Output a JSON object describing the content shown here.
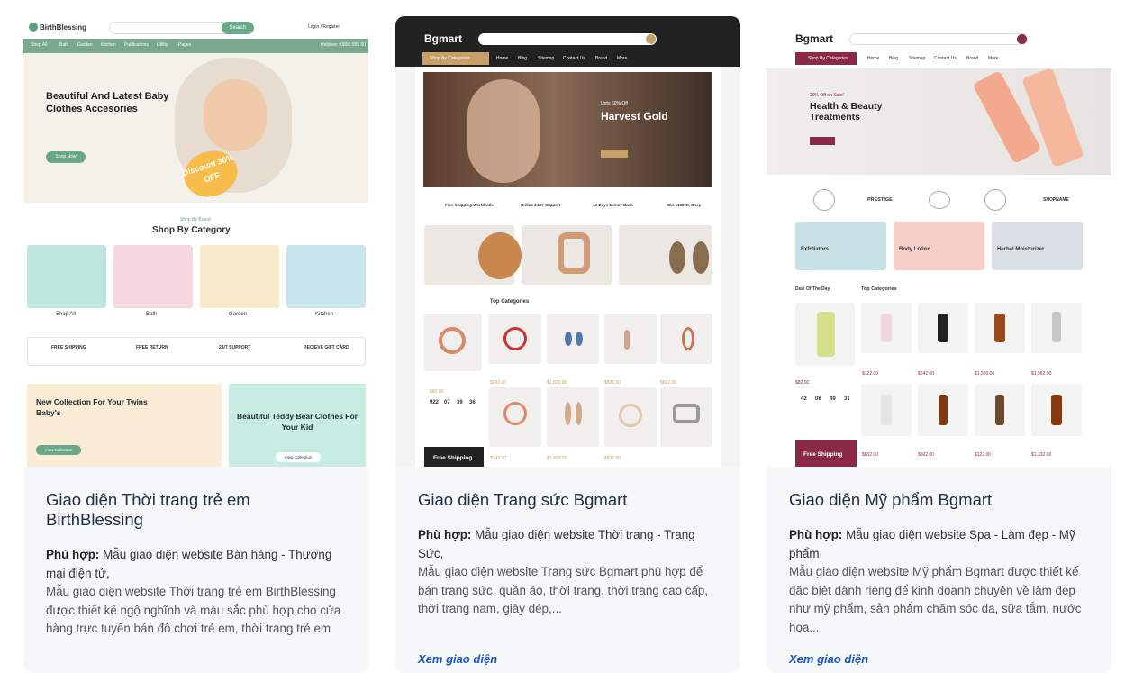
{
  "cards": [
    {
      "title": "Giao diện Thời trang trẻ em BirthBlessing",
      "fit_label": "Phù hợp:",
      "fit_text": "Mẫu giao diện website Bán hàng - Thương mại điện tử,",
      "description": "Mẫu giao diện website Thời trang trẻ em BirthBlessing được thiết kế ngộ nghĩnh và màu sắc phù hợp cho cửa hàng trực tuyến bán đồ chơi trẻ em, thời trang trẻ em",
      "link": "Xem giao diện",
      "preview": {
        "logo": "BirthBlessing",
        "search_btn": "Search",
        "login": "Login / Register",
        "nav": [
          "Shop All",
          "Bath",
          "Garden",
          "Kitchen",
          "Publications",
          "Utility",
          "Pages"
        ],
        "helpline": "Helpline : 0800 555 00",
        "hero_title": "Beautiful And Latest Baby Clothes Accesories",
        "hero_btn": "Shop Now",
        "discount": "Discount 30% OFF",
        "section_sub": "Shop By Brand",
        "section_title": "Shop By Category",
        "categories": [
          "Shop All",
          "Bath",
          "Garden",
          "Kitchen"
        ],
        "features": [
          "FREE SHIPPING",
          "FREE RETURN",
          "24/7 SUPPORT",
          "RECIEVE GIFT CARD"
        ],
        "banner1": "New Collection For Your Twins Baby's",
        "banner2": "Beautiful Teddy Bear Clothes For Your Kid",
        "banner_btn1": "View Collection",
        "banner_btn2": "View Collection"
      }
    },
    {
      "title": "Giao diện Trang sức Bgmart",
      "fit_label": "Phù hợp:",
      "fit_text": "Mẫu giao diện website Thời trang - Trang Sức,",
      "description": "Mẫu giao diện website Trang sức Bgmart phù hợp để bán trang sức, quần áo, thời trang, thời trang cao cấp, thời trang nam, giày dép,...",
      "link": "Xem giao diện",
      "preview": {
        "logo": "Bgmart",
        "categories_btn": "Shop By Categories",
        "nav": [
          "Home",
          "Blog",
          "Sitemap",
          "Contact Us",
          "Brand",
          "More"
        ],
        "hero_title": "Harvest Gold",
        "hero_sub": "Upto 60% Off",
        "features": [
          "Free Shipping Worldwide",
          "Online 24X7 Support",
          "14-Days Money Back",
          "Win $100 To Shop"
        ],
        "section_title": "Top Categories",
        "prices": [
          "$82.00",
          "$242.00",
          "$1,820.00",
          "$602.00",
          "$822.00",
          "$242.00",
          "$1,820.00",
          "$602.00"
        ],
        "countdown": [
          "922",
          "07",
          "39",
          "36"
        ],
        "bottom_tag": "Free Shipping"
      }
    },
    {
      "title": "Giao diện Mỹ phẩm Bgmart",
      "fit_label": "Phù hợp:",
      "fit_text": "Mẫu giao diện website Spa - Làm đẹp - Mỹ phẩm,",
      "description": "Mẫu giao diện website Mỹ phẩm Bgmart được thiết kế đặc biệt dành riêng để kinh doanh chuyên về làm đẹp như mỹ phẩm, sản phẩm chăm sóc da, sữa tắm, nước hoa...",
      "link": "Xem giao diện",
      "preview": {
        "logo": "Bgmart",
        "categories_btn": "Shop By Categories",
        "nav": [
          "Home",
          "Blog",
          "Sitemap",
          "Contact Us",
          "Brand",
          "More"
        ],
        "hero_sub": "20% Off on Sale!",
        "hero_title": "Health & Beauty Treatments",
        "brands": [
          "",
          "PRESTIGE",
          "",
          "",
          "SHOPNAME"
        ],
        "promos": [
          "Exfoliators",
          "Body Lotion",
          "Herbal Moisturizer"
        ],
        "deal_title": "Deal Of The Day",
        "section_title": "Top Categories",
        "countdown": [
          "42",
          "08",
          "49",
          "31"
        ],
        "prices": [
          "$82.00",
          "$122.00",
          "$242.00",
          "$1,320.00",
          "$1,962.00",
          "$602.00",
          "$602.00",
          "$122.00",
          "$1,332.00"
        ],
        "bottom_tag": "Free Shipping"
      }
    }
  ]
}
